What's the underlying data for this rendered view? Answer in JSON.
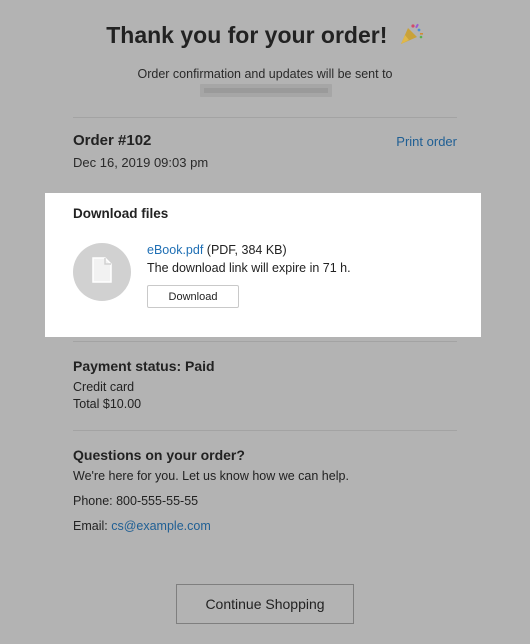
{
  "header": {
    "title": "Thank you for your order!",
    "title_icon": "party-popper-icon",
    "subtitle": "Order confirmation and updates will be sent to"
  },
  "order": {
    "number": "Order #102",
    "date": "Dec 16, 2019 09:03 pm",
    "print_label": "Print order"
  },
  "downloads": {
    "title": "Download files",
    "file_icon": "file-icon",
    "file_link": "eBook.pdf",
    "file_meta": "(PDF, 384 KB)",
    "expire_text": "The download link will expire in 71 h.",
    "button_label": "Download"
  },
  "payment": {
    "status": "Payment status: Paid",
    "method": "Credit card",
    "total": "Total $10.00"
  },
  "questions": {
    "title": "Questions on your order?",
    "help_text": "We're here for you. Let us know how we can help.",
    "phone": "Phone: 800-555-55-55",
    "email_label": "Email:",
    "email": "cs@example.com"
  },
  "actions": {
    "continue_label": "Continue Shopping"
  },
  "colors": {
    "overlay_bg": "#b3b3b3",
    "card_bg": "#ffffff",
    "link": "#1f5f94"
  }
}
